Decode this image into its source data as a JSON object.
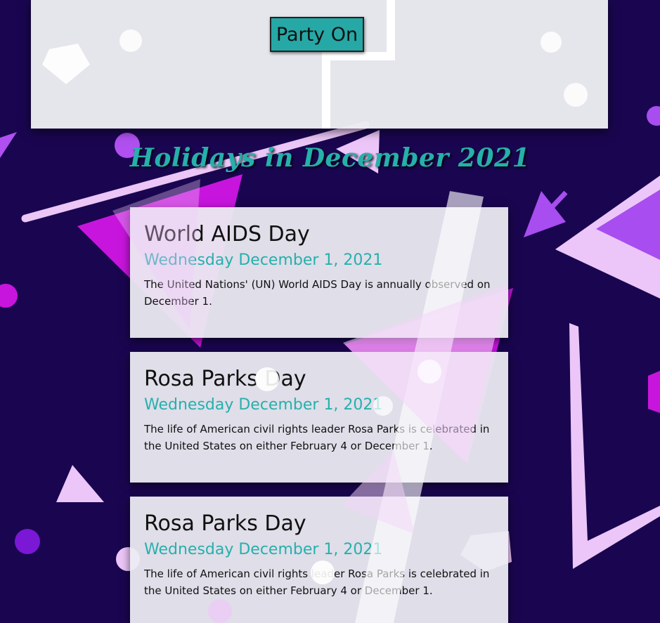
{
  "top_button": {
    "label": "Party On"
  },
  "heading": "Holidays in December 2021",
  "holidays": [
    {
      "name": "World AIDS Day",
      "date": "Wednesday December 1, 2021",
      "description": "The United Nations' (UN) World AIDS Day is annually observed on December 1."
    },
    {
      "name": "Rosa Parks Day",
      "date": "Wednesday December 1, 2021",
      "description": "The life of American civil rights leader Rosa Parks is celebrated in the United States on either February 4 or December 1."
    },
    {
      "name": "Rosa Parks Day",
      "date": "Wednesday December 1, 2021",
      "description": "The life of American civil rights leader Rosa Parks is celebrated in the United States on either February 4 or December 1."
    }
  ],
  "colors": {
    "background": "#1a0650",
    "accent_teal": "#26b0ac",
    "shape_magenta": "#d020e8",
    "shape_light_pink": "#f0c8f8",
    "shape_purple": "#9a40f0",
    "card_background": "#ececf2"
  }
}
